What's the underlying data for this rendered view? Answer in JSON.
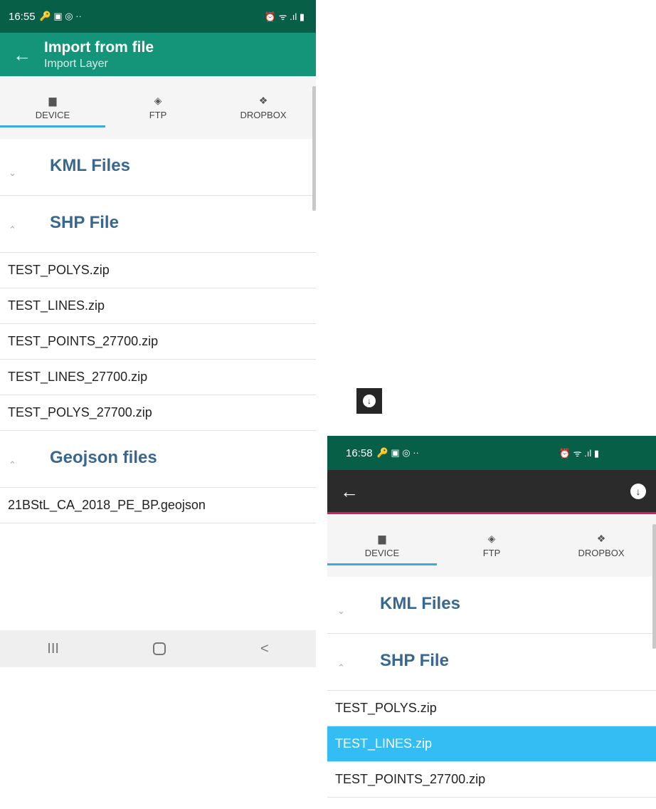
{
  "phone1": {
    "status": {
      "time": "16:55",
      "left_icons": "🔑 ▣ ◎ ··",
      "right_icons": "⏰ ᯤ .ıl ▮"
    },
    "appbar": {
      "title": "Import from file",
      "subtitle": "Import Layer"
    },
    "tabs": [
      {
        "label": "DEVICE",
        "icon": "sd-card-icon",
        "glyph": "▆"
      },
      {
        "label": "FTP",
        "icon": "ftp-icon",
        "glyph": "◈"
      },
      {
        "label": "DROPBOX",
        "icon": "dropbox-icon",
        "glyph": "❖"
      }
    ],
    "sections": {
      "kml": "KML Files",
      "shp": "SHP File",
      "geojson": "Geojson files"
    },
    "shp_files": [
      "TEST_POLYS.zip",
      "TEST_LINES.zip",
      "TEST_POINTS_27700.zip",
      "TEST_LINES_27700.zip",
      "TEST_POLYS_27700.zip"
    ],
    "geojson_files": [
      "21BStL_CA_2018_PE_BP.geojson"
    ],
    "nav": {
      "recents": "III",
      "back": "<"
    }
  },
  "phone2": {
    "status": {
      "time": "16:58",
      "left_icons": "🔑 ▣ ◎ ··",
      "right_icons": "⏰ ᯤ .ıl ▮"
    },
    "tabs": [
      {
        "label": "DEVICE",
        "icon": "sd-card-icon",
        "glyph": "▆"
      },
      {
        "label": "FTP",
        "icon": "ftp-icon",
        "glyph": "◈"
      },
      {
        "label": "DROPBOX",
        "icon": "dropbox-icon",
        "glyph": "❖"
      }
    ],
    "sections": {
      "kml": "KML Files",
      "shp": "SHP File"
    },
    "shp_files": [
      "TEST_POLYS.zip",
      "TEST_LINES.zip",
      "TEST_POINTS_27700.zip"
    ],
    "selected_file": "TEST_LINES.zip"
  },
  "icons": {
    "back": "←",
    "download": "↓",
    "chevron_down": "⌄",
    "chevron_up": "⌃"
  },
  "colors": {
    "status_bar": "#075f48",
    "app_bar": "#14957a",
    "selected_row": "#33bdf2",
    "section_title": "#386790",
    "tab_indicator": "#3da9e0"
  }
}
